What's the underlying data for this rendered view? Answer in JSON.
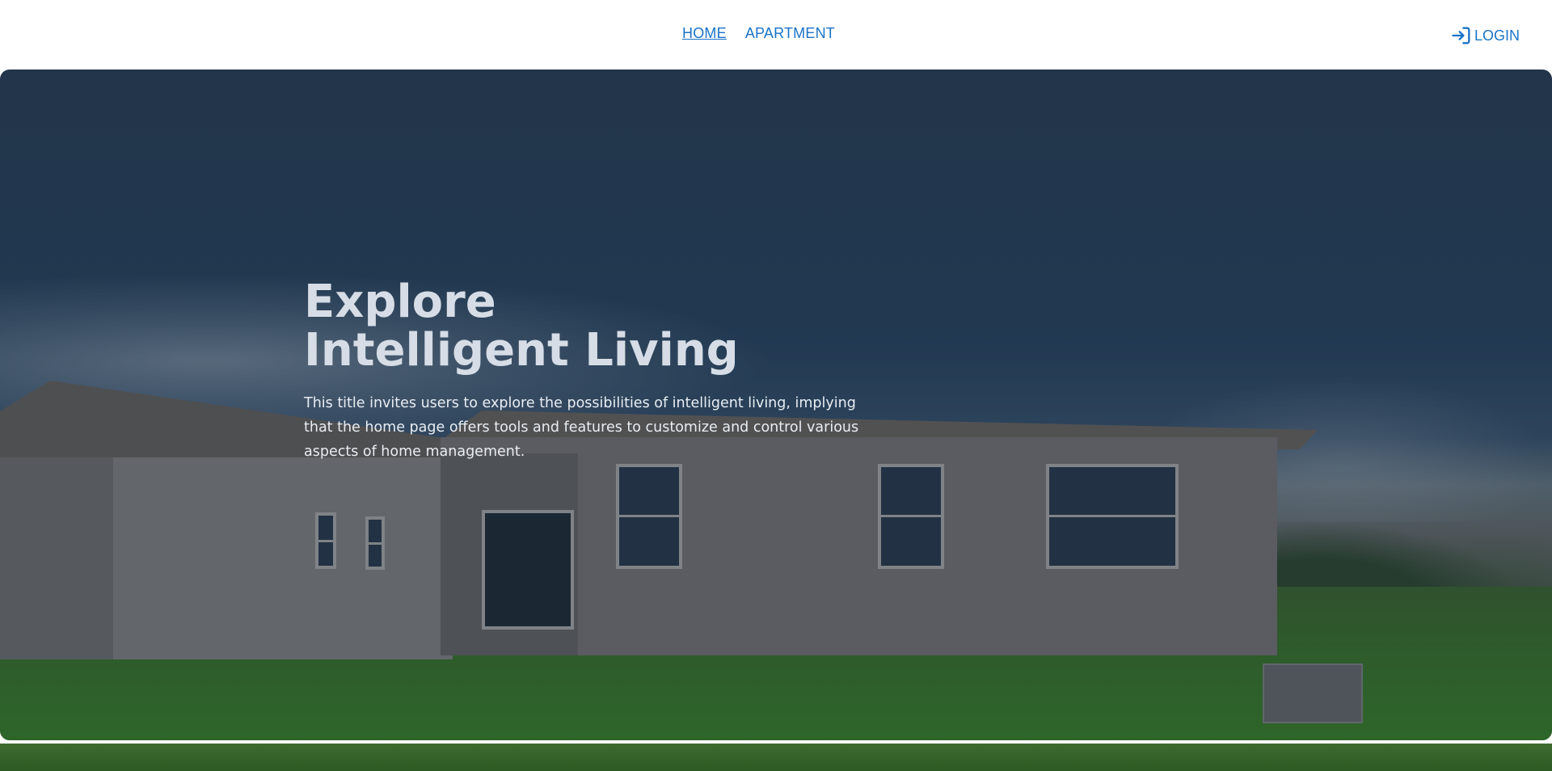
{
  "nav": {
    "items": [
      {
        "label": "HOME",
        "active": true
      },
      {
        "label": "APARTMENT",
        "active": false
      }
    ],
    "login_label": "LOGIN",
    "login_icon": "login-icon",
    "accent_color": "#1a73c8"
  },
  "hero": {
    "title": "Explore Intelligent Living",
    "description": "This title invites users to explore the possibilities of intelligent living, implying that the home page offers tools and features to customize and control various aspects of home management."
  }
}
